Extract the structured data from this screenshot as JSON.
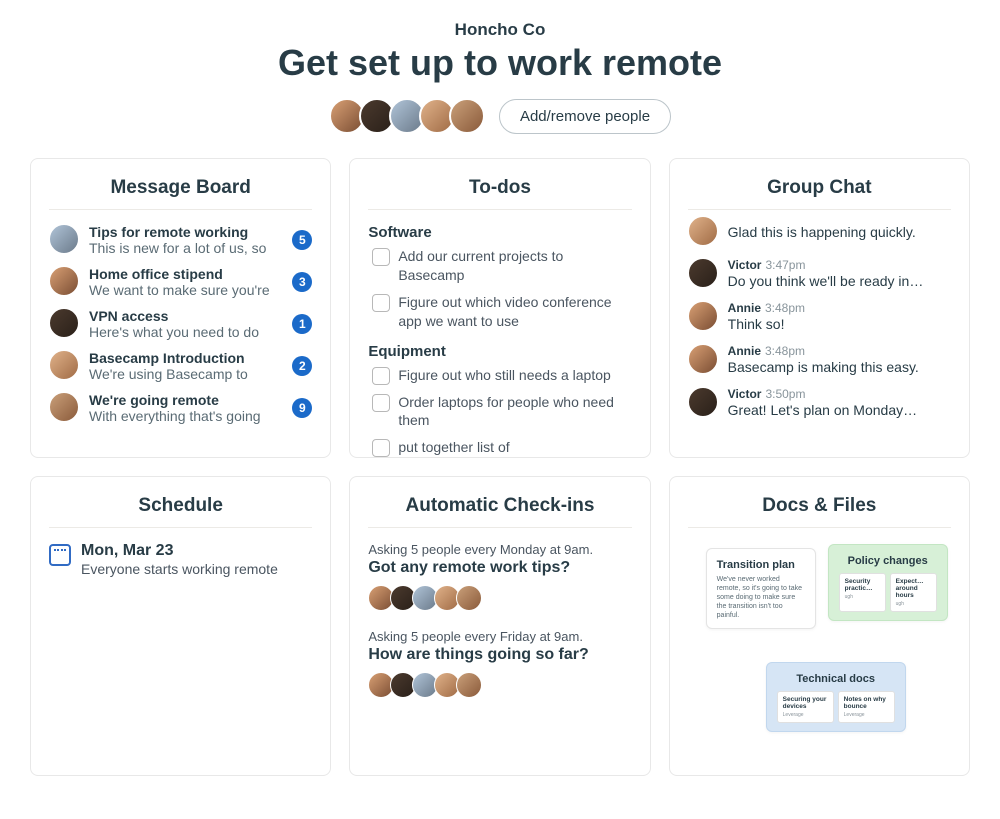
{
  "header": {
    "company": "Honcho Co",
    "title": "Get set up to work remote",
    "add_remove_label": "Add/remove people"
  },
  "cards": {
    "message_board": {
      "title": "Message Board",
      "items": [
        {
          "title": "Tips for remote working",
          "preview": "This is new for a lot of us, so",
          "count": "5"
        },
        {
          "title": "Home office stipend",
          "preview": "We want to make sure you're",
          "count": "3"
        },
        {
          "title": "VPN access",
          "preview": "Here's what you need to do",
          "count": "1"
        },
        {
          "title": "Basecamp Introduction",
          "preview": "We're using Basecamp to",
          "count": "2"
        },
        {
          "title": "We're going remote",
          "preview": "With everything that's going",
          "count": "9"
        }
      ]
    },
    "todos": {
      "title": "To-dos",
      "lists": [
        {
          "name": "Software",
          "items": [
            "Add our current projects to Basecamp",
            "Figure out which video conference app we want to use"
          ]
        },
        {
          "name": "Equipment",
          "items": [
            "Figure out who still needs a laptop",
            "Order laptops for people who need them",
            "put together list of"
          ]
        }
      ]
    },
    "group_chat": {
      "title": "Group Chat",
      "messages": [
        {
          "author": "",
          "time": "",
          "text": "Glad this is happening quickly."
        },
        {
          "author": "Victor",
          "time": "3:47pm",
          "text": "Do you think we'll be ready in…"
        },
        {
          "author": "Annie",
          "time": "3:48pm",
          "text": "Think so!"
        },
        {
          "author": "Annie",
          "time": "3:48pm",
          "text": "Basecamp is making this easy."
        },
        {
          "author": "Victor",
          "time": "3:50pm",
          "text": "Great! Let's plan on Monday…"
        }
      ]
    },
    "schedule": {
      "title": "Schedule",
      "events": [
        {
          "date": "Mon, Mar 23",
          "desc": "Everyone starts working remote"
        }
      ]
    },
    "checkins": {
      "title": "Automatic Check-ins",
      "items": [
        {
          "meta": "Asking 5 people every Monday at 9am.",
          "question": "Got any remote work tips?"
        },
        {
          "meta": "Asking 5 people every Friday at 9am.",
          "question": "How are things going so far?"
        }
      ]
    },
    "docs": {
      "title": "Docs & Files",
      "tiles": {
        "transition": {
          "title": "Transition plan",
          "body": "We've never worked remote, so it's going to take some doing to make sure the transition isn't too painful."
        },
        "policy": {
          "title": "Policy changes",
          "sub1_title": "Security practic…",
          "sub1_text": "ugh",
          "sub2_title": "Expect… around hours",
          "sub2_text": "ugh"
        },
        "technical": {
          "title": "Technical docs",
          "sub1_title": "Securing your devices",
          "sub1_text": "Leverage",
          "sub2_title": "Notes on why bounce",
          "sub2_text": "Leverage"
        }
      }
    }
  }
}
